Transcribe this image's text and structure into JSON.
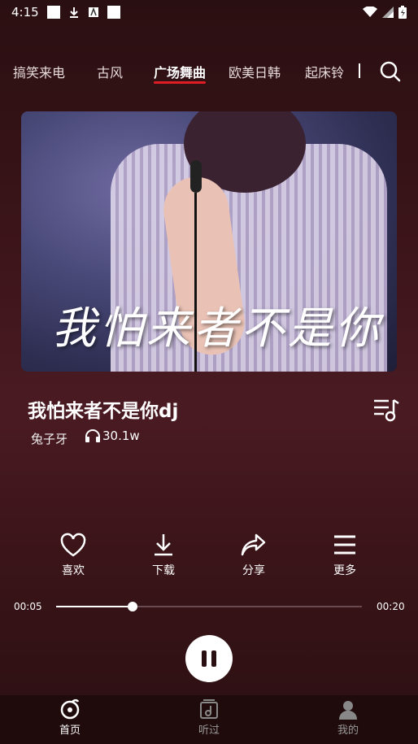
{
  "status": {
    "time": "4:15"
  },
  "tabs": [
    {
      "label": "搞笑来电"
    },
    {
      "label": "古风"
    },
    {
      "label": "广场舞曲",
      "active": true
    },
    {
      "label": "欧美日韩"
    },
    {
      "label": "起床铃"
    }
  ],
  "album_text": "我怕来者不是你",
  "song": {
    "title": "我怕来者不是你dj",
    "singer": "兔子牙",
    "plays": "30.1w"
  },
  "actions": {
    "like": "喜欢",
    "download": "下载",
    "share": "分享",
    "more": "更多"
  },
  "progress": {
    "current": "00:05",
    "total": "00:20",
    "fraction": 0.25
  },
  "nav": {
    "home": "首页",
    "history": "听过",
    "mine": "我的"
  },
  "colors": {
    "accent": "#e01c24",
    "background": "#3a1418"
  }
}
